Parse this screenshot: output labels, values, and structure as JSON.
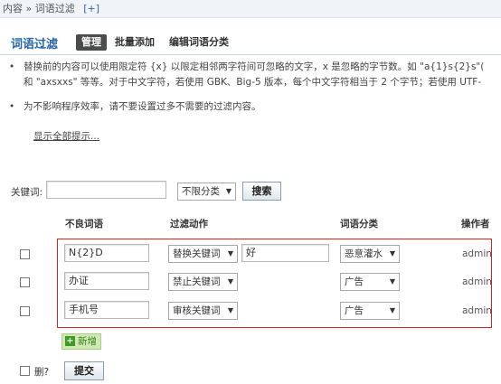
{
  "breadcrumb": {
    "root": "内容",
    "sep": "»",
    "current": "词语过滤",
    "add_label": "[+]"
  },
  "page": {
    "title": "词语过滤"
  },
  "tabs": [
    {
      "label": "管理",
      "active": true
    },
    {
      "label": "批量添加",
      "active": false
    },
    {
      "label": "编辑词语分类",
      "active": false
    }
  ],
  "tips": [
    {
      "bullet": "•",
      "line1": "替换前的内容可以使用限定符 {x} 以限定相邻两字符间可忽略的文字，x 是忽略的字节数。如 \"a{1}s{2}s\"(",
      "line2": "和 \"axsxxs\" 等等。对于中文字符，若使用 GBK、Big-5 版本，每个中文字符相当于 2 个字节；若使用 UTF-"
    },
    {
      "bullet": "•",
      "line1": "为不影响程序效率，请不要设置过多不需要的过滤内容。"
    }
  ],
  "show_all_label": "显示全部提示...",
  "search": {
    "label": "关键词:",
    "value": "",
    "category_selected": "不限分类",
    "submit_label": "搜索"
  },
  "table": {
    "headers": {
      "word": "不良词语",
      "action": "过滤动作",
      "category": "词语分类",
      "operator": "操作者"
    },
    "rows": [
      {
        "word": "N{2}D",
        "action": "替换关键词",
        "replacement": "好",
        "category": "恶意灌水",
        "operator": "admin"
      },
      {
        "word": "办证",
        "action": "禁止关键词",
        "replacement": "",
        "category": "广告",
        "operator": "admin"
      },
      {
        "word": "手机号",
        "action": "审核关键词",
        "replacement": "",
        "category": "广告",
        "operator": "admin"
      }
    ]
  },
  "add_label": "新增",
  "footer": {
    "delete_label": "删?",
    "submit_label": "提交"
  },
  "colors": {
    "accent": "#2366a8",
    "highlight_frame": "#e02020",
    "add_button_bg": "#cfe9b5",
    "tab_active_bg": "#4c4c4c"
  },
  "icons": {
    "add": "plus-icon",
    "select_arrow": "triangle-down-icon"
  }
}
